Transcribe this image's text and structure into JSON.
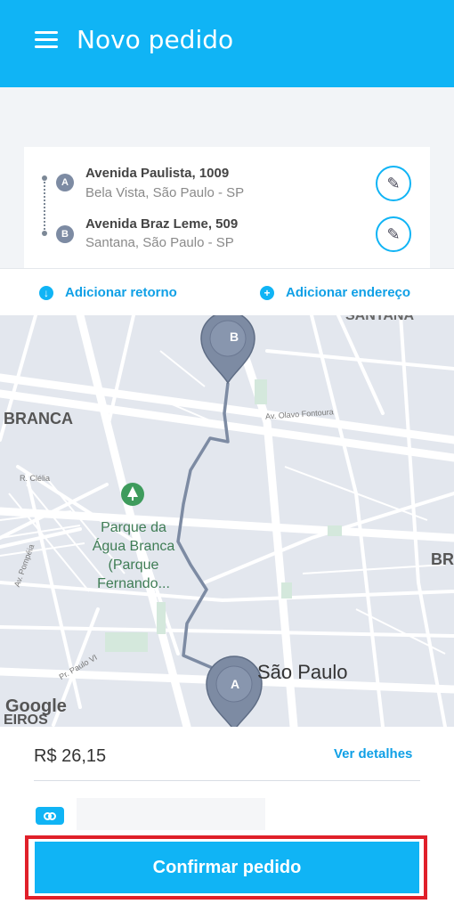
{
  "header": {
    "title": "Novo pedido",
    "menu_icon": "hamburger-menu-icon"
  },
  "route": {
    "origin": {
      "badge": "A",
      "street": "Avenida Paulista, 1009",
      "area": "Bela Vista, São Paulo - SP"
    },
    "destination": {
      "badge": "B",
      "street": "Avenida Braz Leme, 509",
      "area": "Santana, São Paulo - SP"
    }
  },
  "actions": {
    "add_return": "Adicionar retorno",
    "add_address": "Adicionar endereço"
  },
  "map": {
    "labels": {
      "santana": "SANTANA",
      "branca": "BRANCA",
      "olavo": "Av. Olavo Fontoura",
      "clelia": "R. Clélia",
      "pompeia": "Av. Pompéia",
      "paulo_vi": "Pr. Paulo VI",
      "park": "Parque da Água Branca (Parque Fernando...",
      "sao_paulo": "São Paulo",
      "bra": "BRA",
      "eiros": "EIROS"
    },
    "attribution": "Google",
    "pin_a": "A",
    "pin_b": "B"
  },
  "summary": {
    "price": "R$ 26,15",
    "details": "Ver detalhes"
  },
  "confirm": {
    "label": "Confirmar pedido"
  },
  "colors": {
    "primary": "#10b4f5",
    "highlight": "#e0202a",
    "pin": "#7d8ba3"
  }
}
